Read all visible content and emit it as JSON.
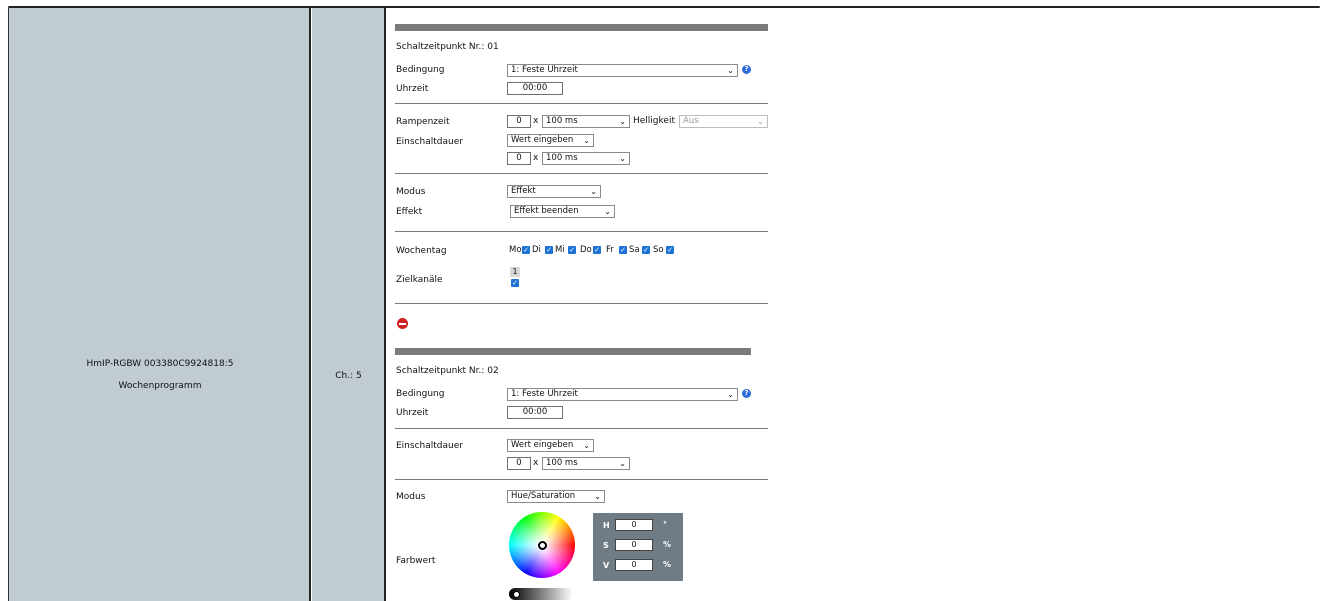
{
  "device": {
    "name": "HmIP-RGBW 003380C9924818:5",
    "program": "Wochenprogramm",
    "channel": "Ch.: 5"
  },
  "slot1": {
    "title": "Schaltzeitpunkt Nr.: 01",
    "condition_label": "Bedingung",
    "condition_value": "1: Feste Uhrzeit",
    "time_label": "Uhrzeit",
    "time_value": "00:00",
    "ramp_label": "Rampenzeit",
    "ramp_value": "0",
    "ramp_unit": "100 ms",
    "brightness_label": "Helligkeit",
    "brightness_value": "Aus",
    "duration_label": "Einschaltdauer",
    "duration_mode": "Wert eingeben",
    "duration_value": "0",
    "duration_unit": "100 ms",
    "mode_label": "Modus",
    "mode_value": "Effekt",
    "effect_label": "Effekt",
    "effect_value": "Effekt beenden",
    "weekday_label": "Wochentag",
    "days": [
      "Mo",
      "Di",
      "Mi",
      "Do",
      "Fr",
      "Sa",
      "So"
    ],
    "days_checked": [
      true,
      true,
      true,
      true,
      true,
      true,
      true
    ],
    "target_label": "Zielkanäle",
    "target_channel": "1",
    "times_sign": "x"
  },
  "slot2": {
    "title": "Schaltzeitpunkt Nr.: 02",
    "condition_label": "Bedingung",
    "condition_value": "1: Feste Uhrzeit",
    "time_label": "Uhrzeit",
    "time_value": "00:00",
    "duration_label": "Einschaltdauer",
    "duration_mode": "Wert eingeben",
    "duration_value": "0",
    "duration_unit": "100 ms",
    "mode_label": "Modus",
    "mode_value": "Hue/Saturation",
    "color_label": "Farbwert",
    "h_label": "H",
    "h_value": "0",
    "h_unit": "°",
    "s_label": "S",
    "s_value": "0",
    "s_unit": "%",
    "v_label": "V",
    "v_value": "0",
    "v_unit": "%",
    "times_sign": "x"
  },
  "colors": {
    "side_panel": "#c1ccd2",
    "bar": "#7b7b7b",
    "checkbox": "#1f73d8",
    "delete": "#d22222"
  }
}
